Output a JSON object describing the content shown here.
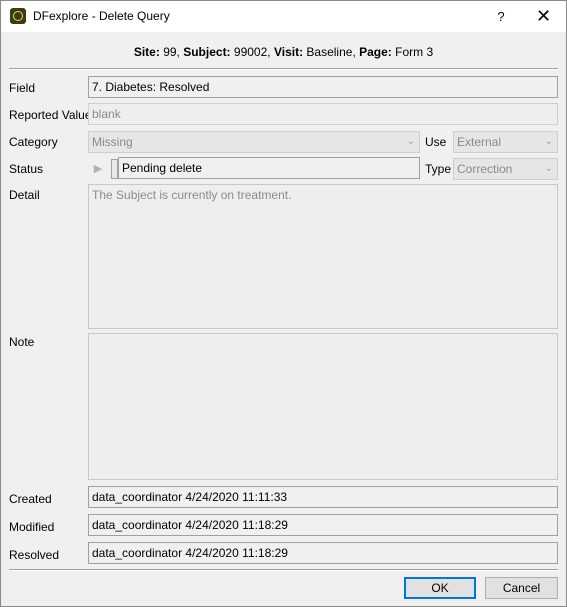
{
  "window": {
    "title": "DFexplore - Delete Query",
    "help": "?",
    "close": "✕"
  },
  "header": {
    "site_label": "Site:",
    "site_value": " 99,",
    "subject_label": "Subject:",
    "subject_value": " 99002,",
    "visit_label": "Visit:",
    "visit_value": " Baseline,",
    "page_label": "Page:",
    "page_value": " Form 3"
  },
  "form": {
    "field_label": "Field",
    "field_value": "7. Diabetes: Resolved",
    "reported_label": "Reported Value",
    "reported_value": "blank",
    "category_label": "Category",
    "category_value": "Missing",
    "use_label": "Use",
    "use_value": "External",
    "status_label": "Status",
    "status_value": "Pending delete",
    "type_label": "Type",
    "type_value": "Correction",
    "detail_label": "Detail",
    "detail_value": "The Subject is currently on treatment.",
    "note_label": "Note",
    "note_value": "",
    "created_label": "Created",
    "created_value": "data_coordinator 4/24/2020 11:11:33",
    "modified_label": "Modified",
    "modified_value": "data_coordinator 4/24/2020 11:18:29",
    "resolved_label": "Resolved",
    "resolved_value": "data_coordinator 4/24/2020 11:18:29"
  },
  "buttons": {
    "ok": "OK",
    "cancel": "Cancel"
  }
}
